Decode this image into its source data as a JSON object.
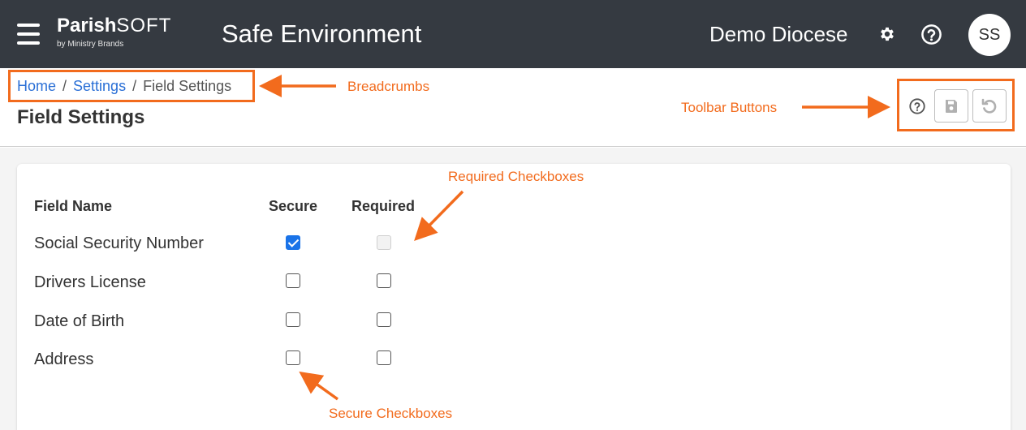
{
  "navbar": {
    "logo_main_bold": "Parish",
    "logo_main_thin": "SOFT",
    "logo_sub": "by Ministry Brands",
    "app_title": "Safe Environment",
    "diocese": "Demo Diocese",
    "avatar_initials": "SS",
    "icons": [
      "menu-icon",
      "gear-icon",
      "help-icon"
    ]
  },
  "breadcrumb": {
    "items": [
      {
        "label": "Home",
        "link": true
      },
      {
        "label": "Settings",
        "link": true
      },
      {
        "label": "Field Settings",
        "link": false
      }
    ],
    "separator": "/"
  },
  "page": {
    "title": "Field Settings"
  },
  "toolbar": {
    "icons": [
      "help-icon",
      "save-icon",
      "undo-icon"
    ]
  },
  "annotations": {
    "breadcrumbs": "Breadcrumbs",
    "toolbar": "Toolbar Buttons",
    "required": "Required Checkboxes",
    "secure": "Secure Checkboxes",
    "color": "#f26b1d"
  },
  "table": {
    "headers": {
      "field_name": "Field Name",
      "secure": "Secure",
      "required": "Required"
    },
    "rows": [
      {
        "label": "Social Security Number",
        "secure": true,
        "required": false,
        "required_disabled": true
      },
      {
        "label": "Drivers License",
        "secure": false,
        "required": false,
        "required_disabled": false
      },
      {
        "label": "Date of Birth",
        "secure": false,
        "required": false,
        "required_disabled": false
      },
      {
        "label": "Address",
        "secure": false,
        "required": false,
        "required_disabled": false
      }
    ]
  },
  "colors": {
    "navbar_bg": "#353a41",
    "link": "#2a6fd6",
    "checkbox_checked": "#1a73e8",
    "annotation": "#f26b1d"
  }
}
